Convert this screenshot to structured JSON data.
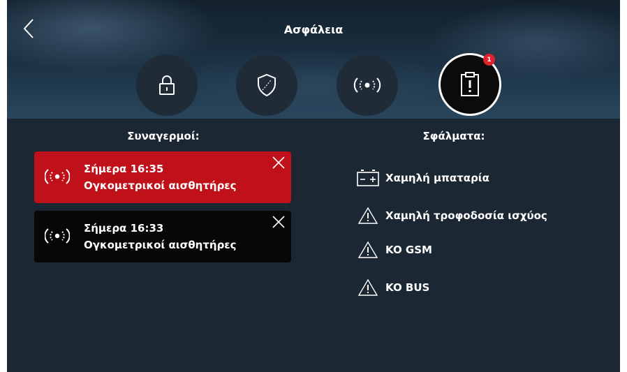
{
  "header": {
    "title": "Ασφάλεια"
  },
  "tabs": [
    {
      "icon": "lock-icon",
      "active": false
    },
    {
      "icon": "shield-icon",
      "active": false
    },
    {
      "icon": "wireless-alarm-icon",
      "active": false
    },
    {
      "icon": "clipboard-alert-icon",
      "active": true,
      "badge": "1"
    }
  ],
  "alarms": {
    "title": "Συναγερμοί:",
    "items": [
      {
        "time": "Σήμερα 16:35",
        "label": "Ογκομετρικοί αισθητήρες",
        "color": "#c0101a"
      },
      {
        "time": "Σήμερα 16:33",
        "label": "Ογκομετρικοί αισθητήρες",
        "color": "#070707"
      }
    ]
  },
  "errors": {
    "title": "Σφάλματα:",
    "items": [
      {
        "icon": "battery-icon",
        "label": "Χαμηλή μπαταρία"
      },
      {
        "icon": "warning-icon",
        "label": "Χαμηλή τροφοδοσία ισχύος"
      },
      {
        "icon": "warning-icon",
        "label": "KO GSM"
      },
      {
        "icon": "warning-icon",
        "label": "KO BUS"
      }
    ]
  },
  "colors": {
    "background": "#1b2833",
    "alarm_active": "#c0101a",
    "badge": "#e0212e"
  }
}
